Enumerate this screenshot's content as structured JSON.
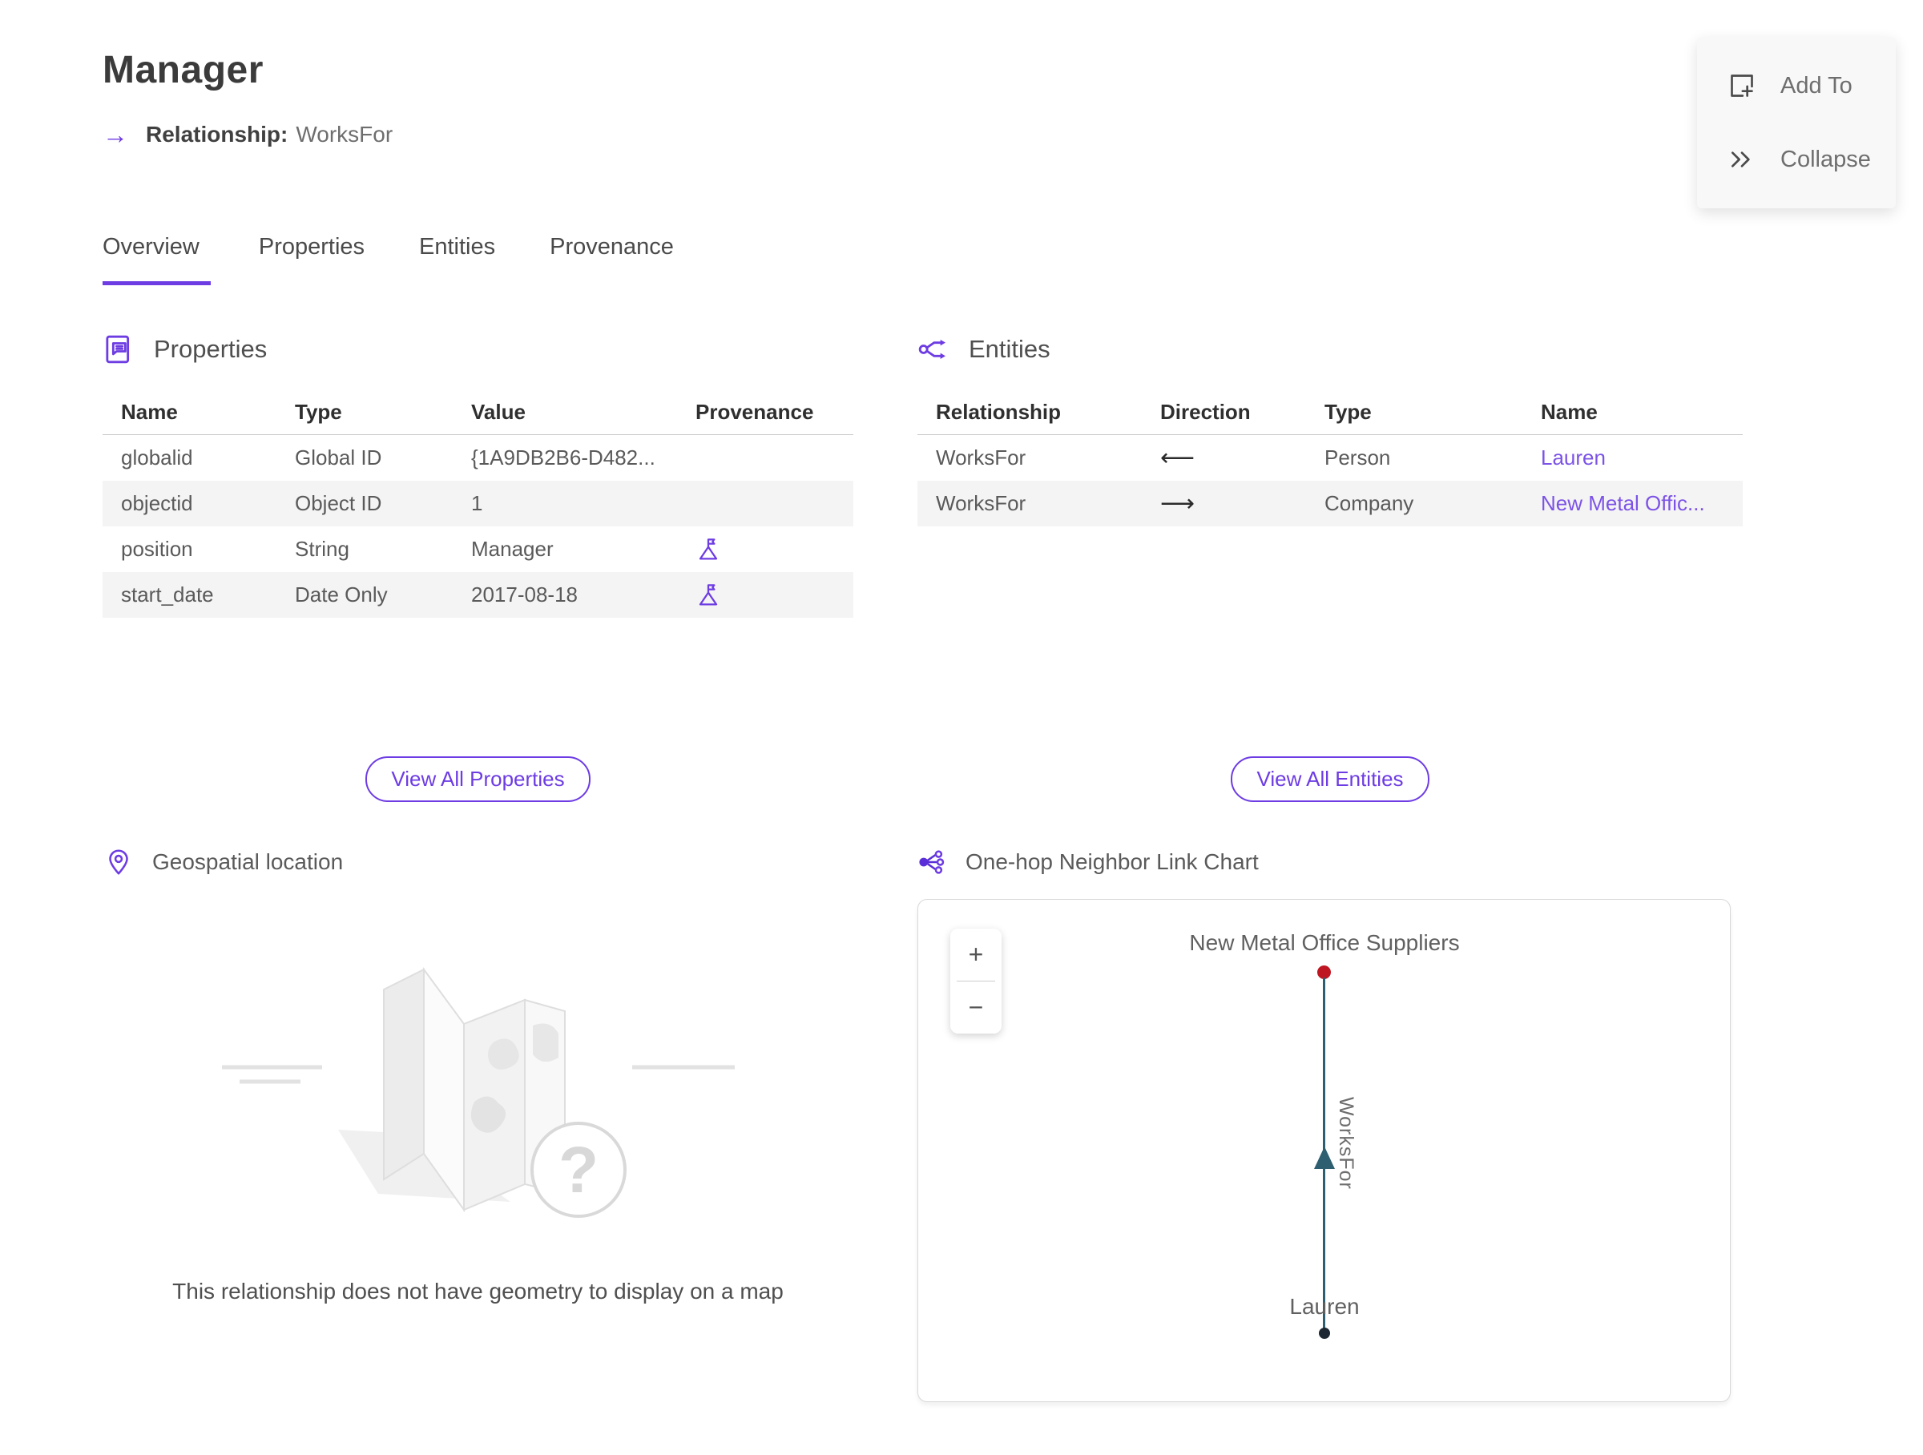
{
  "header": {
    "title": "Manager",
    "subtitle_label": "Relationship:",
    "subtitle_value": "WorksFor"
  },
  "icons": {
    "relationship_arrow": "→",
    "question_glyph": "?"
  },
  "actions": {
    "add_to": "Add To",
    "collapse": "Collapse"
  },
  "tabs": {
    "items": [
      {
        "label": "Overview"
      },
      {
        "label": "Properties"
      },
      {
        "label": "Entities"
      },
      {
        "label": "Provenance"
      }
    ],
    "active": "Overview"
  },
  "properties_section": {
    "title": "Properties",
    "columns": {
      "name": "Name",
      "type": "Type",
      "value": "Value",
      "provenance": "Provenance"
    },
    "rows": [
      {
        "name": "globalid",
        "type": "Global ID",
        "value": "{1A9DB2B6-D482...",
        "has_provenance_flag": false
      },
      {
        "name": "objectid",
        "type": "Object ID",
        "value": "1",
        "has_provenance_flag": false
      },
      {
        "name": "position",
        "type": "String",
        "value": "Manager",
        "has_provenance_flag": true
      },
      {
        "name": "start_date",
        "type": "Date Only",
        "value": "2017-08-18",
        "has_provenance_flag": true
      }
    ],
    "view_all_label": "View All Properties"
  },
  "entities_section": {
    "title": "Entities",
    "columns": {
      "relationship": "Relationship",
      "direction": "Direction",
      "type": "Type",
      "name": "Name"
    },
    "rows": [
      {
        "relationship": "WorksFor",
        "direction": "⟵",
        "type": "Person",
        "name": "Lauren"
      },
      {
        "relationship": "WorksFor",
        "direction": "⟶",
        "type": "Company",
        "name": "New Metal Offic..."
      }
    ],
    "view_all_label": "View All Entities"
  },
  "geospatial": {
    "title": "Geospatial location",
    "empty_message": "This relationship does not have geometry to display on a map"
  },
  "link_chart": {
    "title": "One-hop Neighbor Link Chart",
    "zoom_in_label": "+",
    "zoom_out_label": "−",
    "edge": {
      "label": "WorksFor",
      "color": "#2d5f70",
      "direction": "up"
    },
    "nodes": [
      {
        "label": "New Metal Office Suppliers",
        "type": "Company",
        "color": "#bf1722",
        "position": "top"
      },
      {
        "label": "Lauren",
        "type": "Person",
        "color": "#1c2733",
        "position": "bottom"
      }
    ]
  },
  "colors": {
    "accent_purple": "#6d3ce3",
    "link_purple": "#7c53e6",
    "edge_teal": "#2d5f70",
    "node_red": "#bf1722",
    "node_dark": "#1c2733",
    "row_stripe": "#f4f4f4"
  }
}
